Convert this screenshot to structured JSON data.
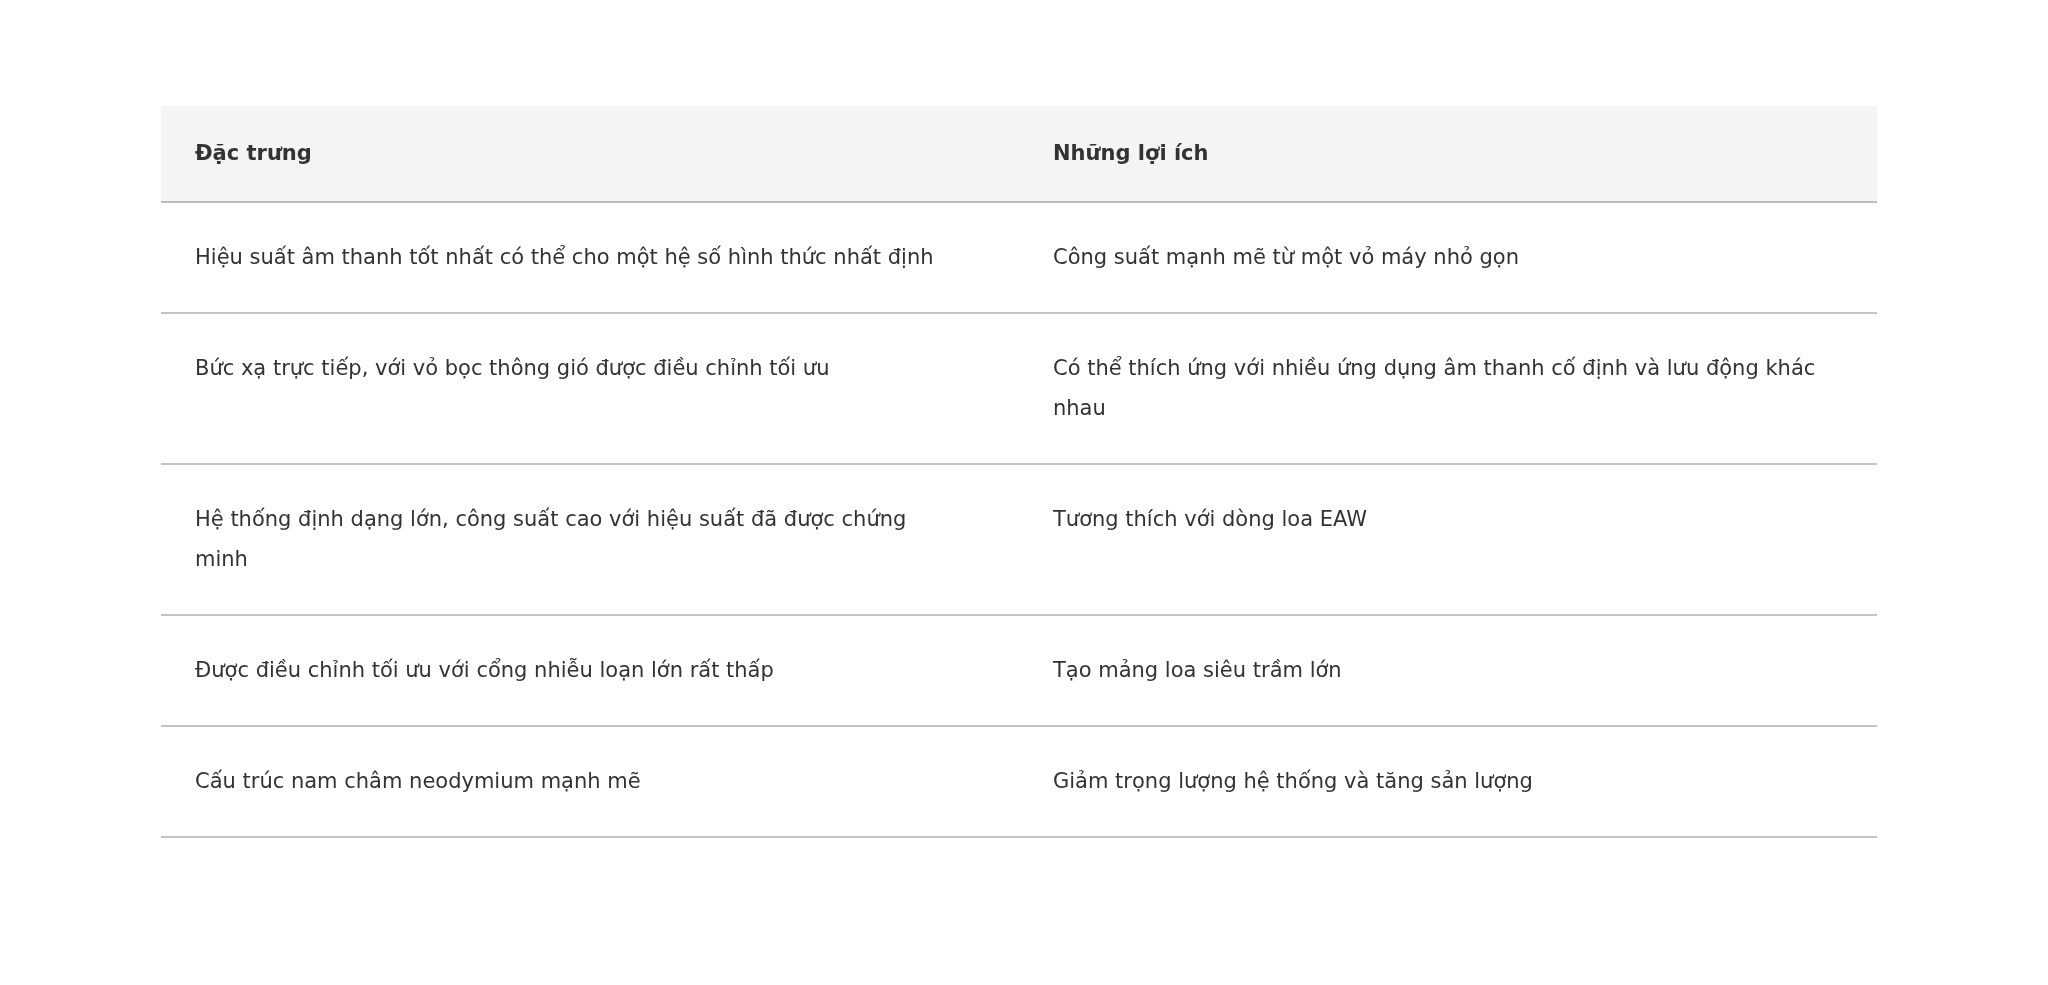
{
  "table": {
    "columns": [
      "Đặc trưng",
      "Những lợi ích"
    ],
    "rows": [
      [
        "Hiệu suất âm thanh tốt nhất có thể cho một hệ số hình thức nhất định",
        "Công suất mạnh mẽ từ một vỏ máy nhỏ gọn"
      ],
      [
        "Bức xạ trực tiếp, với vỏ bọc thông gió được điều chỉnh tối ưu",
        "Có thể thích ứng với nhiều ứng dụng âm thanh cố định và lưu động khác nhau"
      ],
      [
        "Hệ thống định dạng lớn, công suất cao với hiệu suất đã được chứng minh",
        "Tương thích với dòng loa EAW"
      ],
      [
        "Được điều chỉnh tối ưu với cổng nhiễu loạn lớn rất thấp",
        "Tạo mảng loa siêu trầm lớn"
      ],
      [
        "Cấu trúc nam châm neodymium mạnh mẽ",
        "Giảm trọng lượng hệ thống và tăng sản lượng"
      ]
    ]
  }
}
